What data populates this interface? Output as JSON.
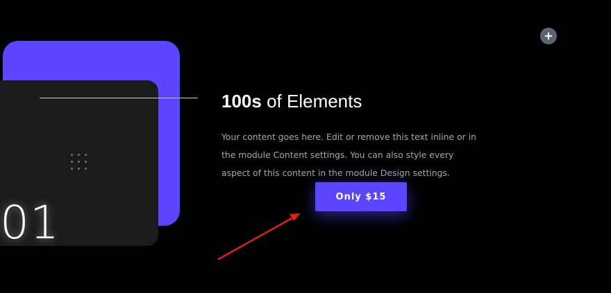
{
  "card": {
    "number": "01"
  },
  "content": {
    "heading_bold": "100s",
    "heading_rest": "of Elements",
    "body": "Your content goes here. Edit or remove this text inline or in the module Content settings. You can also style every aspect of this content in the module Design settings."
  },
  "button": {
    "label": "Only $15"
  },
  "icons": {
    "add": "plus-icon",
    "grid": "grid-dots-icon",
    "annotation": "arrow-icon"
  },
  "colors": {
    "accent": "#5b45ff",
    "background": "#000000",
    "card": "#1b1b1b",
    "annotation": "#e11d1d",
    "add_button": "#5d6675"
  }
}
